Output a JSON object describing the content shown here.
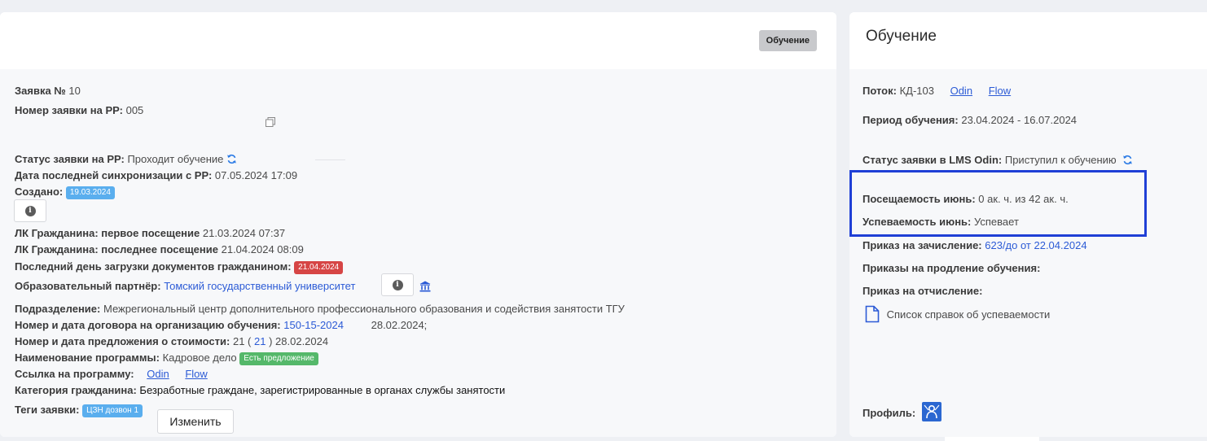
{
  "left": {
    "header_button": "Обучение",
    "request_no": {
      "label": "Заявка №",
      "value": "10"
    },
    "rr_number": {
      "label": "Номер заявки на РР:",
      "value": "005"
    },
    "rr_status": {
      "label": "Статус заявки на РР:",
      "value": "Проходит обучение"
    },
    "last_sync": {
      "label": "Дата последней синхронизации с РР:",
      "value": "07.05.2024 17:09"
    },
    "created": {
      "label": "Создано:",
      "badge": "19.03.2024"
    },
    "first_visit": {
      "label": "ЛК Гражданина: первое посещение",
      "value": "21.03.2024 07:37"
    },
    "last_visit": {
      "label": "ЛК Гражданина: последнее посещение",
      "value": "21.04.2024 08:09"
    },
    "last_upload": {
      "label": "Последний день загрузки документов гражданином:",
      "badge": "21.04.2024"
    },
    "partner": {
      "label": "Образовательный партнёр:",
      "value": "Томский государственный университет"
    },
    "division": {
      "label": "Подразделение:",
      "value": "Межрегиональный центр дополнительного профессионального образования и содействия занятости ТГУ"
    },
    "contract": {
      "label": "Номер и дата договора на организацию обучения:",
      "number": "150-15-2024",
      "date": "28.02.2024;"
    },
    "offer": {
      "label": "Номер и дата предложения о стоимости:",
      "prefix": "21 (",
      "link": "21",
      "suffix": ") 28.02.2024"
    },
    "program": {
      "label": "Наименование программы:",
      "value": "Кадровое дело",
      "badge": "Есть предложение"
    },
    "program_link": {
      "label": "Ссылка на программу:",
      "odin": "Odin",
      "flow": "Flow"
    },
    "citizen_category": {
      "label": "Категория гражданина:",
      "value": "Безработные граждане, зарегистрированные в органах службы занятости"
    },
    "tags": {
      "label": "Теги заявки:",
      "badge": "ЦЗН дозвон 1",
      "change_button": "Изменить"
    }
  },
  "right": {
    "title": "Обучение",
    "stream": {
      "label": "Поток:",
      "value": "КД-103",
      "odin": "Odin",
      "flow": "Flow"
    },
    "period": {
      "label": "Период обучения:",
      "value": "23.04.2024 - 16.07.2024"
    },
    "lms_status": {
      "label": "Статус заявки в LMS Odin:",
      "value": "Приступил к обучению"
    },
    "attendance": {
      "label": "Посещаемость июнь:",
      "value": "0 ак. ч. из 42 ак. ч."
    },
    "progress": {
      "label": "Успеваемость июнь:",
      "value": "Успевает"
    },
    "enroll_order": {
      "label": "Приказ на зачисление:",
      "value": "623/до от 22.04.2024"
    },
    "extension_orders": {
      "label": "Приказы на продление обучения:"
    },
    "expel_order": {
      "label": "Приказ на отчисление:"
    },
    "certificates": "Список справок об успеваемости",
    "profile": {
      "label": "Профиль:"
    }
  },
  "colors": {
    "accent": "#2c5bd6",
    "highlight": "#1f3fd6",
    "badge_blue": "#5aaeee",
    "badge_red": "#d64545",
    "badge_green": "#55b86a"
  },
  "icons": [
    "copy-icon",
    "sync-icon",
    "info-icon",
    "bank-icon",
    "document-icon",
    "profile-avatar-icon"
  ]
}
